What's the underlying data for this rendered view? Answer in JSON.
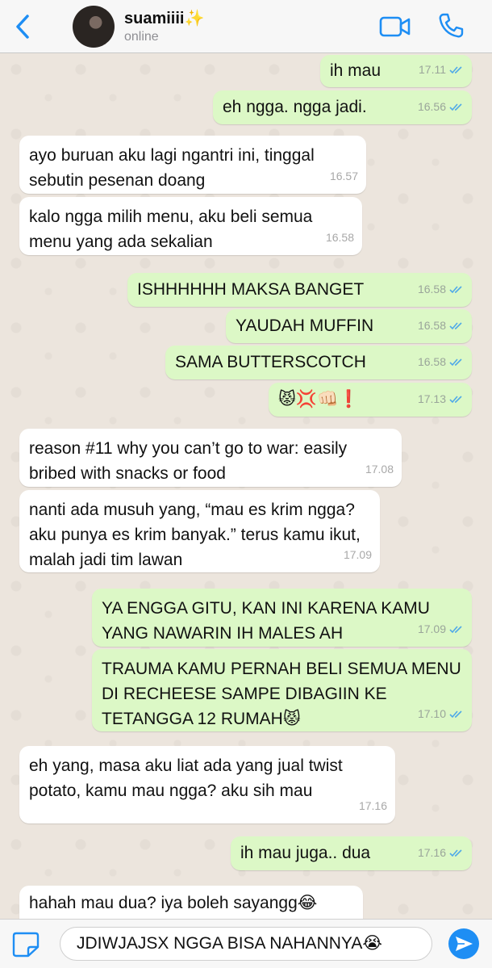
{
  "header": {
    "contact_name": "suamiiii✨",
    "status": "online",
    "icons": [
      "back-chevron-icon",
      "video-call-icon",
      "phone-call-icon"
    ],
    "accent_color": "#1e8ef4"
  },
  "messages": [
    {
      "dir": "out",
      "text": "ih mau",
      "time": "17.11"
    },
    {
      "dir": "out",
      "text": "eh ngga. ngga jadi.",
      "time": "16.56"
    },
    {
      "dir": "in",
      "text": "ayo buruan aku lagi ngantri ini, tinggal sebutin pesenan doang",
      "time": "16.57"
    },
    {
      "dir": "in",
      "text": "kalo ngga milih menu, aku beli semua menu yang ada sekalian",
      "time": "16.58"
    },
    {
      "dir": "out",
      "text": "ISHHHHHH MAKSA BANGET",
      "time": "16.58"
    },
    {
      "dir": "out",
      "text": "YAUDAH MUFFIN",
      "time": "16.58"
    },
    {
      "dir": "out",
      "text": "SAMA BUTTERSCOTCH",
      "time": "16.58"
    },
    {
      "dir": "out",
      "text": "😾💢👊🏻❗",
      "time": "17.13"
    },
    {
      "dir": "in",
      "text": "reason #11 why you can’t go to war: easily bribed with snacks or food",
      "time": "17.08"
    },
    {
      "dir": "in",
      "text": "nanti ada musuh yang, “mau es krim ngga? aku punya es krim banyak.” terus kamu ikut, malah jadi tim lawan",
      "time": "17.09"
    },
    {
      "dir": "out",
      "text": "YA ENGGA GITU, KAN INI KARENA KAMU YANG NAWARIN IH MALES AH",
      "time": "17.09"
    },
    {
      "dir": "out",
      "text": "TRAUMA KAMU PERNAH BELI SEMUA MENU DI RECHEESE SAMPE DIBAGIIN KE TETANGGA 12 RUMAH😾",
      "time": "17.10"
    },
    {
      "dir": "in",
      "text": "eh yang, masa aku liat ada yang jual twist potato, kamu mau ngga? aku sih mau",
      "time": "17.16"
    },
    {
      "dir": "out",
      "text": "ih mau juga.. dua",
      "time": "17.16"
    },
    {
      "dir": "in",
      "text": "hahah mau dua? iya boleh sayangg😂",
      "time": ""
    }
  ],
  "composer": {
    "value": "JDIWJAJSX NGGA BISA NAHANNYA😭",
    "icons": [
      "attach-icon",
      "send-icon"
    ]
  },
  "colors": {
    "outgoing_bubble": "#dcf8c6",
    "incoming_bubble": "#ffffff",
    "read_ticks": "#4fa9e8"
  }
}
